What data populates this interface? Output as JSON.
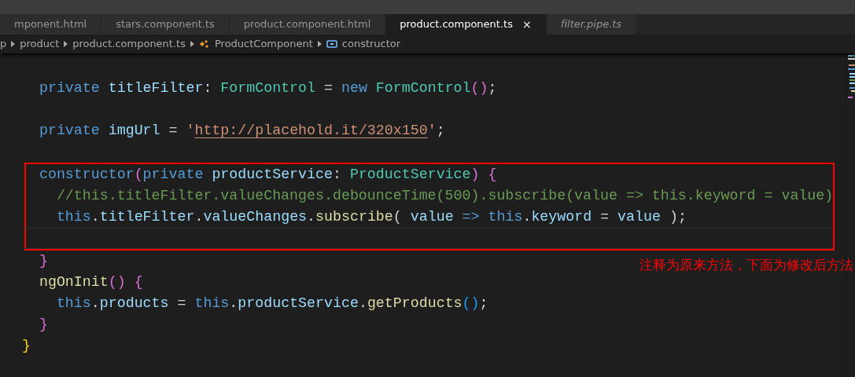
{
  "tabs": [
    {
      "label": "mponent.html",
      "selected": false,
      "preview": false
    },
    {
      "label": "stars.component.ts",
      "selected": false,
      "preview": false
    },
    {
      "label": "product.component.html",
      "selected": false,
      "preview": false
    },
    {
      "label": "product.component.ts",
      "selected": true,
      "preview": false,
      "close": "×"
    },
    {
      "label": "filter.pipe.ts",
      "selected": false,
      "preview": true
    }
  ],
  "breadcrumbs": [
    {
      "label": "p",
      "kind": "folder"
    },
    {
      "label": "product",
      "kind": "folder"
    },
    {
      "label": "product.component.ts",
      "kind": "file"
    },
    {
      "label": "ProductComponent",
      "kind": "class"
    },
    {
      "label": "constructor",
      "kind": "method"
    }
  ],
  "code_groups": [
    {
      "kind": "plain",
      "lines": [
        {
          "kind": "blank"
        },
        {
          "kind": "code",
          "tokens": [
            {
              "text": "  private",
              "kind": "keyword"
            },
            {
              "text": " titleFilter",
              "kind": "variable"
            },
            {
              "text": ": ",
              "kind": "plain"
            },
            {
              "text": "FormControl",
              "kind": "type"
            },
            {
              "text": " = ",
              "kind": "plain"
            },
            {
              "text": "new",
              "kind": "keyword"
            },
            {
              "text": " FormControl",
              "kind": "type"
            },
            {
              "text": "()",
              "kind": "bracket"
            },
            {
              "text": ";",
              "kind": "plain"
            }
          ]
        },
        {
          "kind": "blank"
        },
        {
          "kind": "code",
          "tokens": [
            {
              "text": "  private",
              "kind": "keyword"
            },
            {
              "text": " imgUrl",
              "kind": "variable"
            },
            {
              "text": " = ",
              "kind": "plain"
            },
            {
              "text": "'",
              "kind": "string"
            },
            {
              "text": "http://placehold.it/320x150",
              "kind": "link"
            },
            {
              "text": "'",
              "kind": "string"
            },
            {
              "text": ";",
              "kind": "plain"
            }
          ]
        },
        {
          "kind": "blank"
        }
      ]
    },
    {
      "kind": "boxed",
      "lines": [
        {
          "kind": "code",
          "tokens": [
            {
              "text": "  constructor",
              "kind": "keyword"
            },
            {
              "text": "(",
              "kind": "bracket"
            },
            {
              "text": "private",
              "kind": "keyword"
            },
            {
              "text": " productService",
              "kind": "variable"
            },
            {
              "text": ": ",
              "kind": "plain"
            },
            {
              "text": "ProductService",
              "kind": "type"
            },
            {
              "text": ")",
              "kind": "bracket"
            },
            {
              "text": " {",
              "kind": "bracket"
            }
          ]
        },
        {
          "kind": "code",
          "tokens": [
            {
              "text": "    //this.titleFilter.valueChanges.debounceTime(500).subscribe(value => this.keyword = value)",
              "kind": "comment"
            }
          ]
        },
        {
          "kind": "code",
          "tokens": [
            {
              "text": "    this",
              "kind": "keyword"
            },
            {
              "text": ".",
              "kind": "plain"
            },
            {
              "text": "titleFilter",
              "kind": "variable"
            },
            {
              "text": ".",
              "kind": "plain"
            },
            {
              "text": "valueChanges",
              "kind": "variable"
            },
            {
              "text": ".",
              "kind": "plain"
            },
            {
              "text": "subscribe",
              "kind": "function"
            },
            {
              "text": "( ",
              "kind": "plain"
            },
            {
              "text": "value",
              "kind": "variable"
            },
            {
              "text": " => ",
              "kind": "keyword"
            },
            {
              "text": "this",
              "kind": "keyword"
            },
            {
              "text": ".",
              "kind": "plain"
            },
            {
              "text": "keyword",
              "kind": "variable"
            },
            {
              "text": " = ",
              "kind": "plain"
            },
            {
              "text": "value",
              "kind": "variable"
            },
            {
              "text": " );",
              "kind": "plain"
            }
          ]
        },
        {
          "kind": "current-blank"
        }
      ]
    },
    {
      "kind": "plain",
      "lines": [
        {
          "kind": "code",
          "tokens": [
            {
              "text": "  }",
              "kind": "bracket"
            }
          ]
        },
        {
          "kind": "code",
          "tokens": [
            {
              "text": "  ngOnInit",
              "kind": "function"
            },
            {
              "text": "()",
              "kind": "bracket"
            },
            {
              "text": " {",
              "kind": "bracket"
            }
          ]
        },
        {
          "kind": "code",
          "tokens": [
            {
              "text": "    this",
              "kind": "keyword"
            },
            {
              "text": ".",
              "kind": "plain"
            },
            {
              "text": "products",
              "kind": "variable"
            },
            {
              "text": " = ",
              "kind": "plain"
            },
            {
              "text": "this",
              "kind": "keyword"
            },
            {
              "text": ".",
              "kind": "plain"
            },
            {
              "text": "productService",
              "kind": "variable"
            },
            {
              "text": ".",
              "kind": "plain"
            },
            {
              "text": "getProducts",
              "kind": "function"
            },
            {
              "text": "()",
              "kind": "paren"
            },
            {
              "text": ";",
              "kind": "plain"
            }
          ]
        },
        {
          "kind": "code",
          "tokens": [
            {
              "text": "  }",
              "kind": "bracket"
            }
          ]
        },
        {
          "kind": "code",
          "tokens": [
            {
              "text": "}",
              "kind": "brace"
            }
          ]
        }
      ]
    }
  ],
  "annotation": {
    "text": "注释为原来方法，下面为修改后方法"
  }
}
